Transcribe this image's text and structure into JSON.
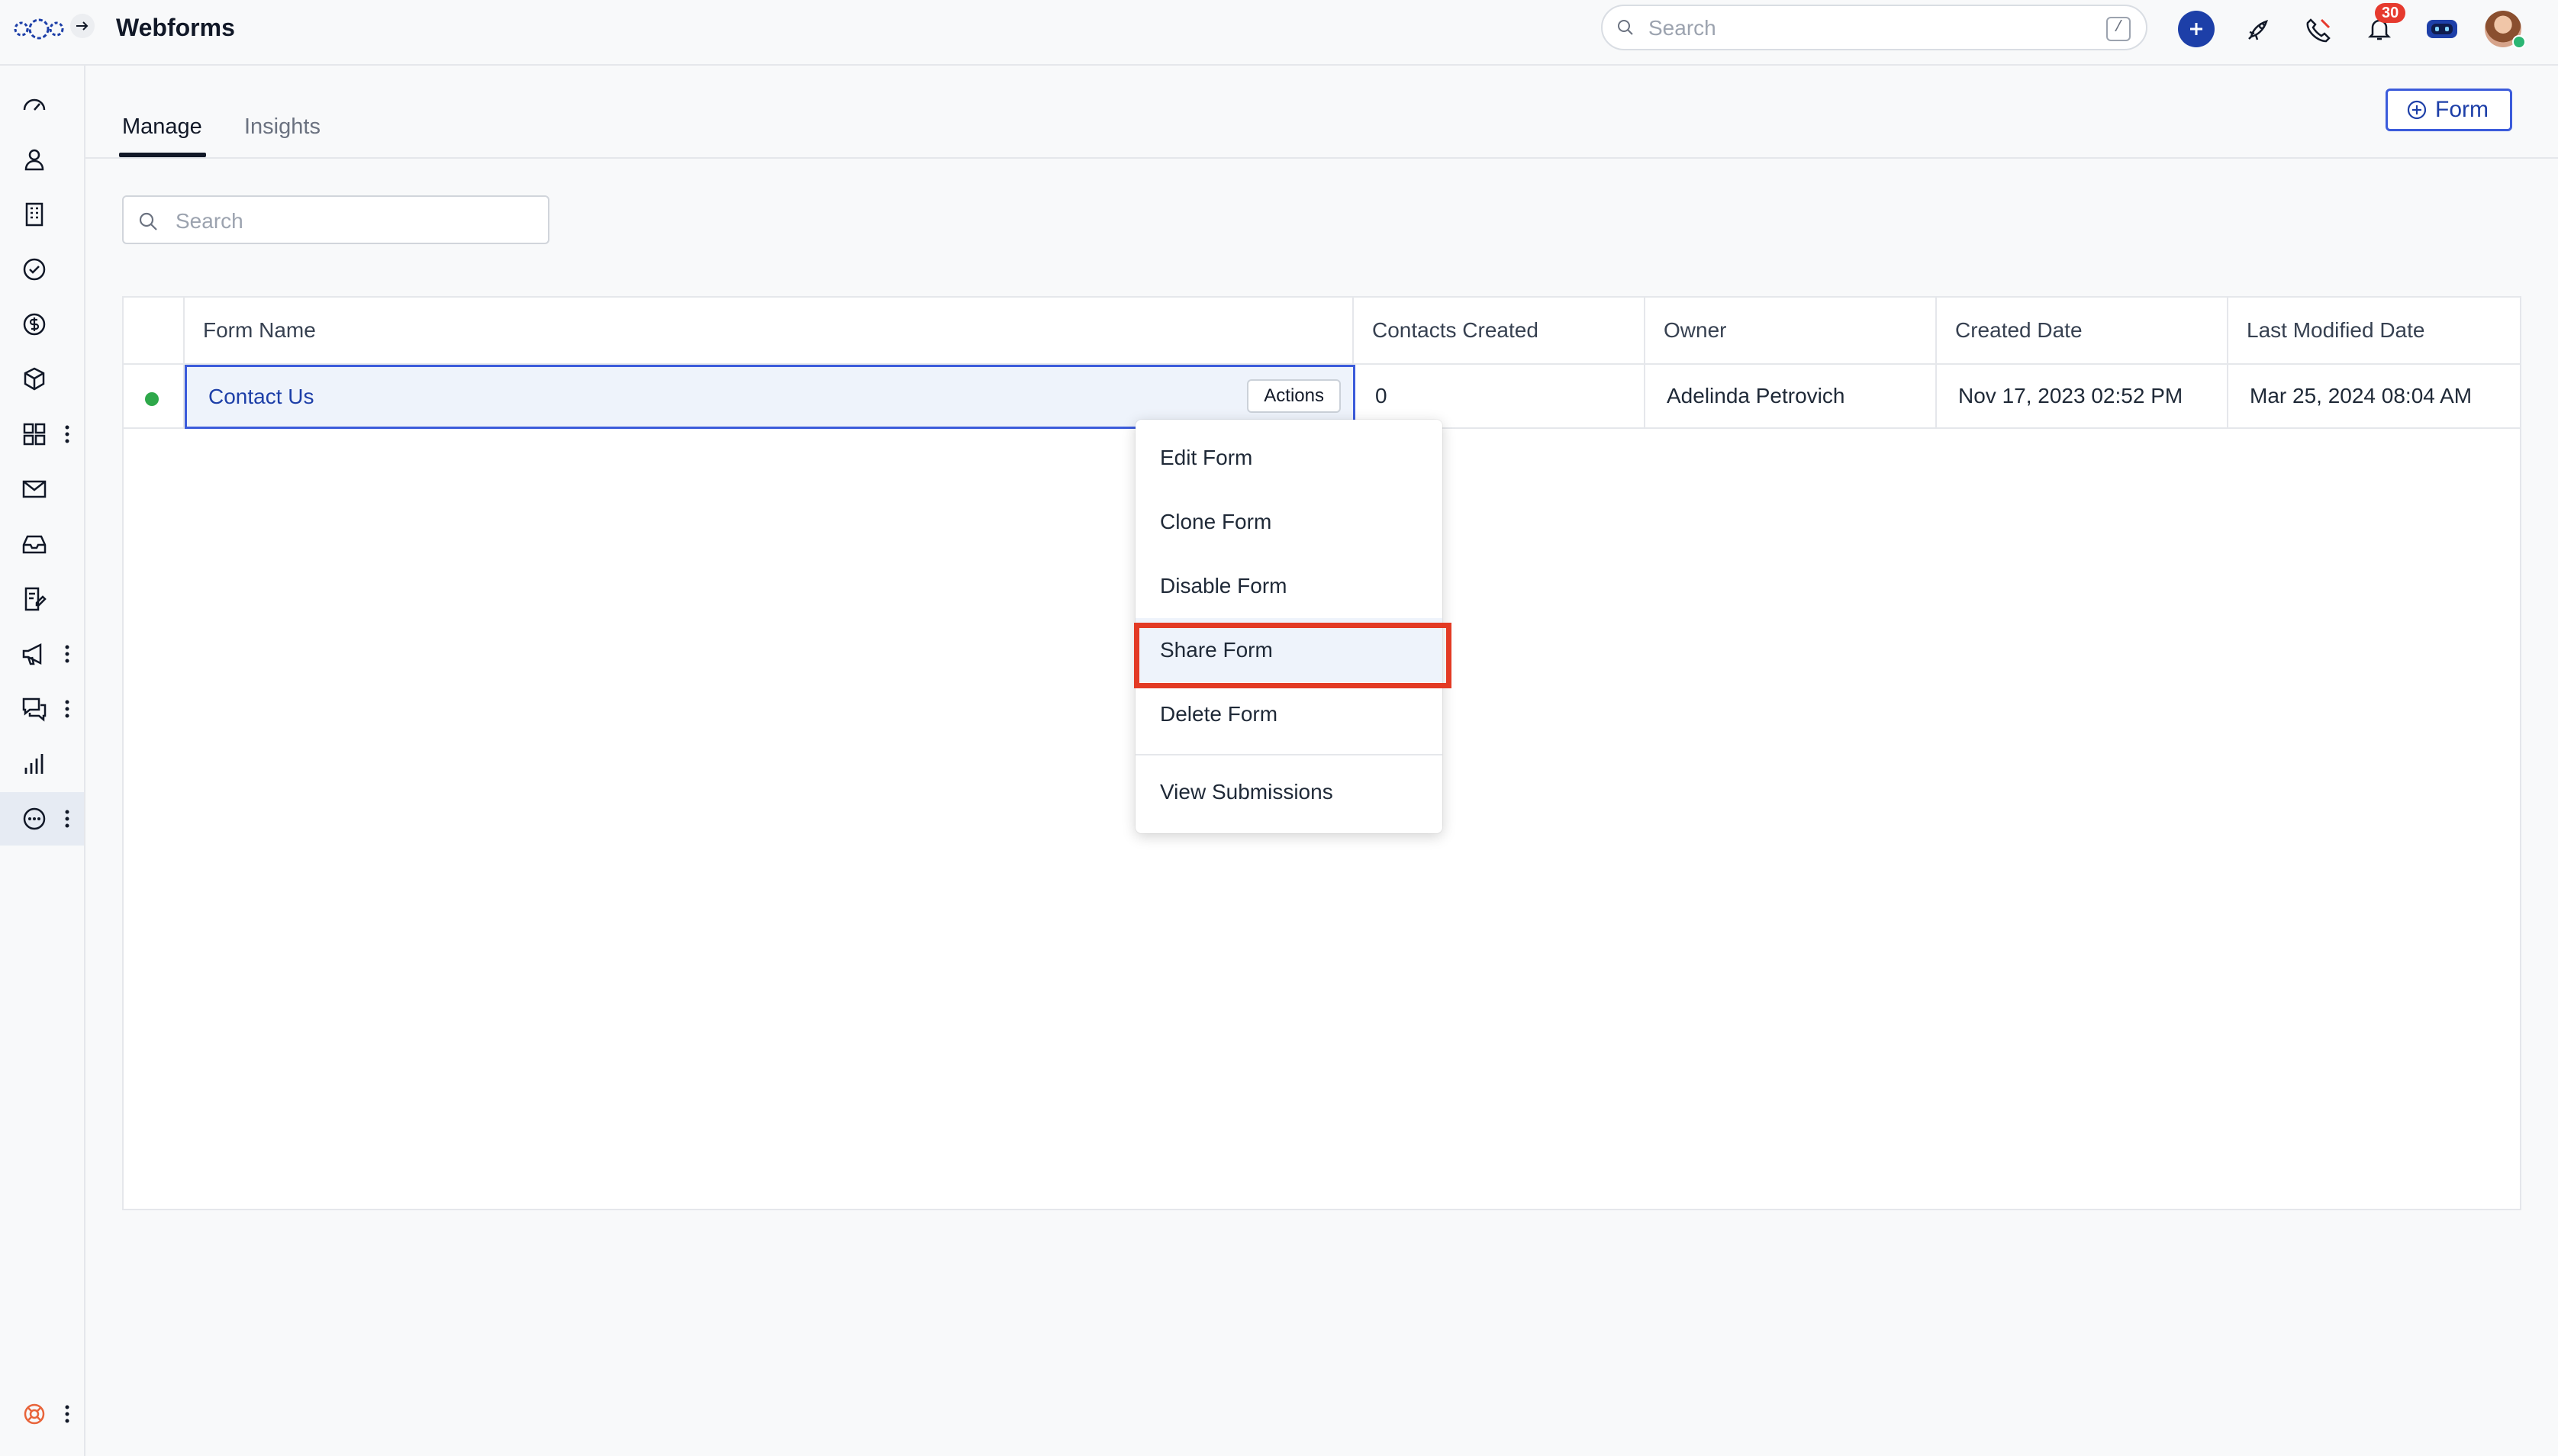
{
  "app": {
    "title": "Webforms"
  },
  "header": {
    "search_placeholder": "Search",
    "search_shortcut": "/",
    "notification_count": "30"
  },
  "sidebar": {
    "icons": [
      "dashboard-icon",
      "contacts-icon",
      "companies-icon",
      "tasks-icon",
      "deals-icon",
      "products-icon",
      "apps-icon",
      "email-icon",
      "inbox-icon",
      "forms-icon",
      "marketing-icon",
      "conversations-icon",
      "reports-icon",
      "more-icon"
    ],
    "active": "more-icon"
  },
  "tabs": [
    {
      "label": "Manage",
      "active": true
    },
    {
      "label": "Insights",
      "active": false
    }
  ],
  "new_form_button": {
    "label": "Form"
  },
  "list_search": {
    "placeholder": "Search"
  },
  "table": {
    "columns": [
      "Form Name",
      "Contacts Created",
      "Owner",
      "Created Date",
      "Last Modified Date"
    ],
    "rows": [
      {
        "status": "active",
        "name": "Contact Us",
        "contacts_created": "0",
        "owner": "Adelinda Petrovich",
        "created_date": "Nov 17, 2023 02:52 PM",
        "modified_date": "Mar 25, 2024 08:04 AM",
        "actions_label": "Actions"
      }
    ]
  },
  "actions_menu": {
    "items": [
      "Edit Form",
      "Clone Form",
      "Disable Form",
      "Share Form",
      "Delete Form"
    ],
    "footer_item": "View Submissions",
    "highlighted": "Share Form"
  },
  "colors": {
    "accent": "#1d3fa8",
    "status_active": "#2ea84a",
    "highlight_border": "#e33a24",
    "badge": "#e63a2e"
  }
}
